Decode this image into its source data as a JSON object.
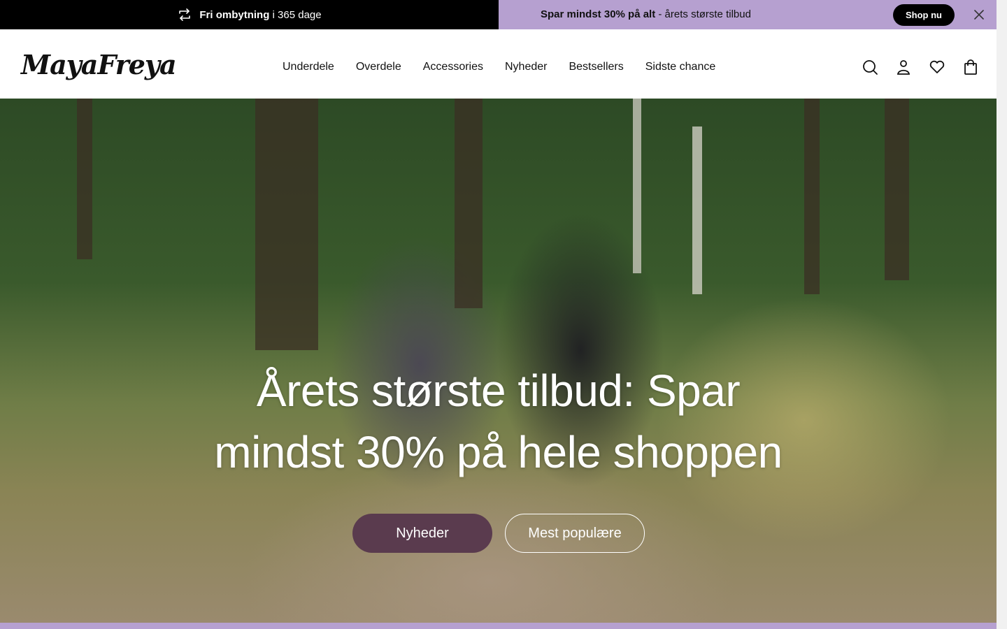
{
  "announcement": {
    "left_bold": "Fri ombytning",
    "left_rest": " i 365 dage",
    "right_bold": "Spar mindst 30% på alt",
    "right_rest": " - årets største tilbud",
    "shop_button": "Shop nu",
    "colors": {
      "left_bg": "#000000",
      "right_bg": "#b6a0d0"
    }
  },
  "header": {
    "logo": "MayaFreya",
    "nav": [
      "Underdele",
      "Overdele",
      "Accessories",
      "Nyheder",
      "Bestsellers",
      "Sidste chance"
    ],
    "icons": [
      "search-icon",
      "account-icon",
      "wishlist-heart-icon",
      "cart-bag-icon"
    ]
  },
  "hero": {
    "title_line1": "Årets største tilbud: Spar",
    "title_line2": "mindst 30% på hele shoppen",
    "primary_button": "Nyheder",
    "secondary_button": "Mest populære",
    "colors": {
      "primary_button_bg": "#5a3b4e"
    }
  }
}
